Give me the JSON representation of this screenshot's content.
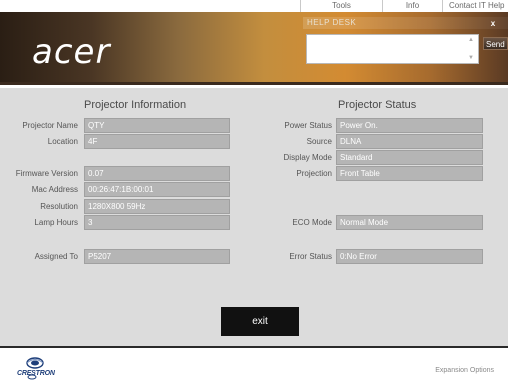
{
  "tabs": [
    "Tools",
    "Info",
    "Contact IT Help"
  ],
  "brand": {
    "logo": "acer"
  },
  "helpdesk": {
    "title": "HELP DESK",
    "close": "x",
    "send": "Send",
    "message": ""
  },
  "projector_info": {
    "heading": "Projector Information",
    "rows": [
      {
        "label": "Projector Name",
        "value": "QTY"
      },
      {
        "label": "Location",
        "value": "4F"
      },
      {
        "label": "Firmware Version",
        "value": "0.07"
      },
      {
        "label": "Mac Address",
        "value": "00:26:47:1B:00:01"
      },
      {
        "label": "Resolution",
        "value": "1280X800 59Hz"
      },
      {
        "label": "Lamp Hours",
        "value": "3"
      },
      {
        "label": "Assigned To",
        "value": "P5207"
      }
    ]
  },
  "projector_status": {
    "heading": "Projector Status",
    "rows": [
      {
        "label": "Power Status",
        "value": "Power On."
      },
      {
        "label": "Source",
        "value": "DLNA"
      },
      {
        "label": "Display Mode",
        "value": "Standard"
      },
      {
        "label": "Projection",
        "value": "Front Table"
      },
      {
        "label": "ECO Mode",
        "value": "Normal Mode"
      },
      {
        "label": "Error Status",
        "value": "0:No Error"
      }
    ]
  },
  "exit_label": "exit",
  "footer": {
    "crestron": "CRESTRON",
    "expansion": "Expansion Options"
  },
  "colors": {
    "field_bg": "#b5b5b5",
    "panel_bg": "#dcdcdc",
    "header_orange": "#d38b32"
  }
}
